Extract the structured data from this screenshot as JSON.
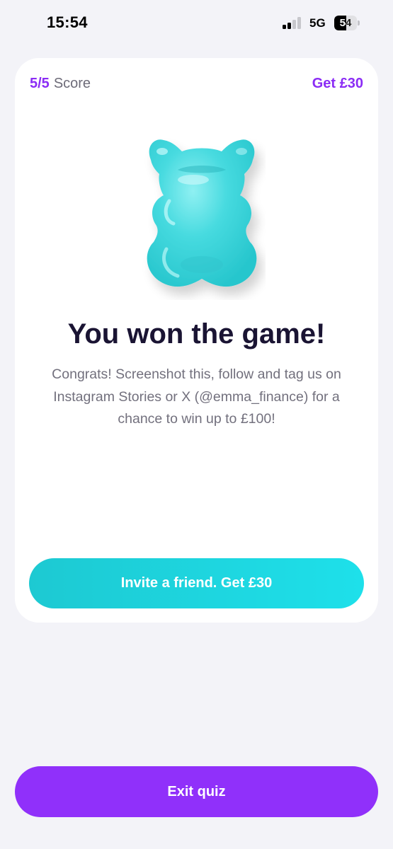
{
  "status_bar": {
    "time": "15:54",
    "network": "5G",
    "signal_bars_filled": 2,
    "signal_bars_total": 4,
    "battery_percent": 54,
    "battery_label": "54"
  },
  "quiz": {
    "score_value": "5/5",
    "score_label": "Score",
    "reward_link": "Get £30",
    "title": "You won the game!",
    "message": "Congrats! Screenshot this, follow and tag us on Instagram Stories or X (@emma_finance) for a chance to win up to £100!",
    "invite_button": "Invite a friend. Get £30",
    "exit_button": "Exit quiz"
  },
  "colors": {
    "background": "#f3f3f8",
    "accent_purple": "#8b2cf5",
    "exit_button": "#9030fa",
    "invite_gradient_start": "#1dc9d2",
    "invite_gradient_end": "#1ee0ea",
    "bear": "#3fd6dc",
    "title_text": "#1a1433",
    "body_text": "#72707d"
  },
  "icons": {
    "signal": "cellular-signal-icon",
    "battery": "battery-icon",
    "mascot": "gummy-bear-icon"
  }
}
